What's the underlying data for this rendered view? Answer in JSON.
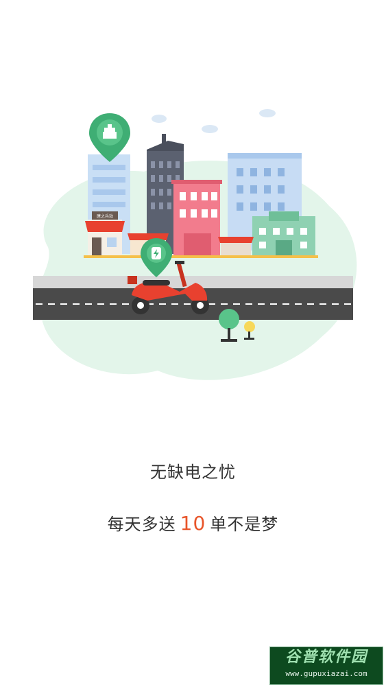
{
  "onboarding": {
    "headline": "无缺电之忧",
    "subline_prefix": "每天多送",
    "subline_highlight": "10",
    "subline_suffix": "单不是梦"
  },
  "illustration": {
    "shop_sign": "唐之兵站"
  },
  "watermark": {
    "title": "谷普软件园",
    "url": "www.gupuxiazai.com"
  },
  "colors": {
    "highlight": "#e8552a",
    "text": "#333333",
    "pin_green": "#3fae74",
    "scooter_red": "#e8412f",
    "road": "#4a4a4a"
  }
}
